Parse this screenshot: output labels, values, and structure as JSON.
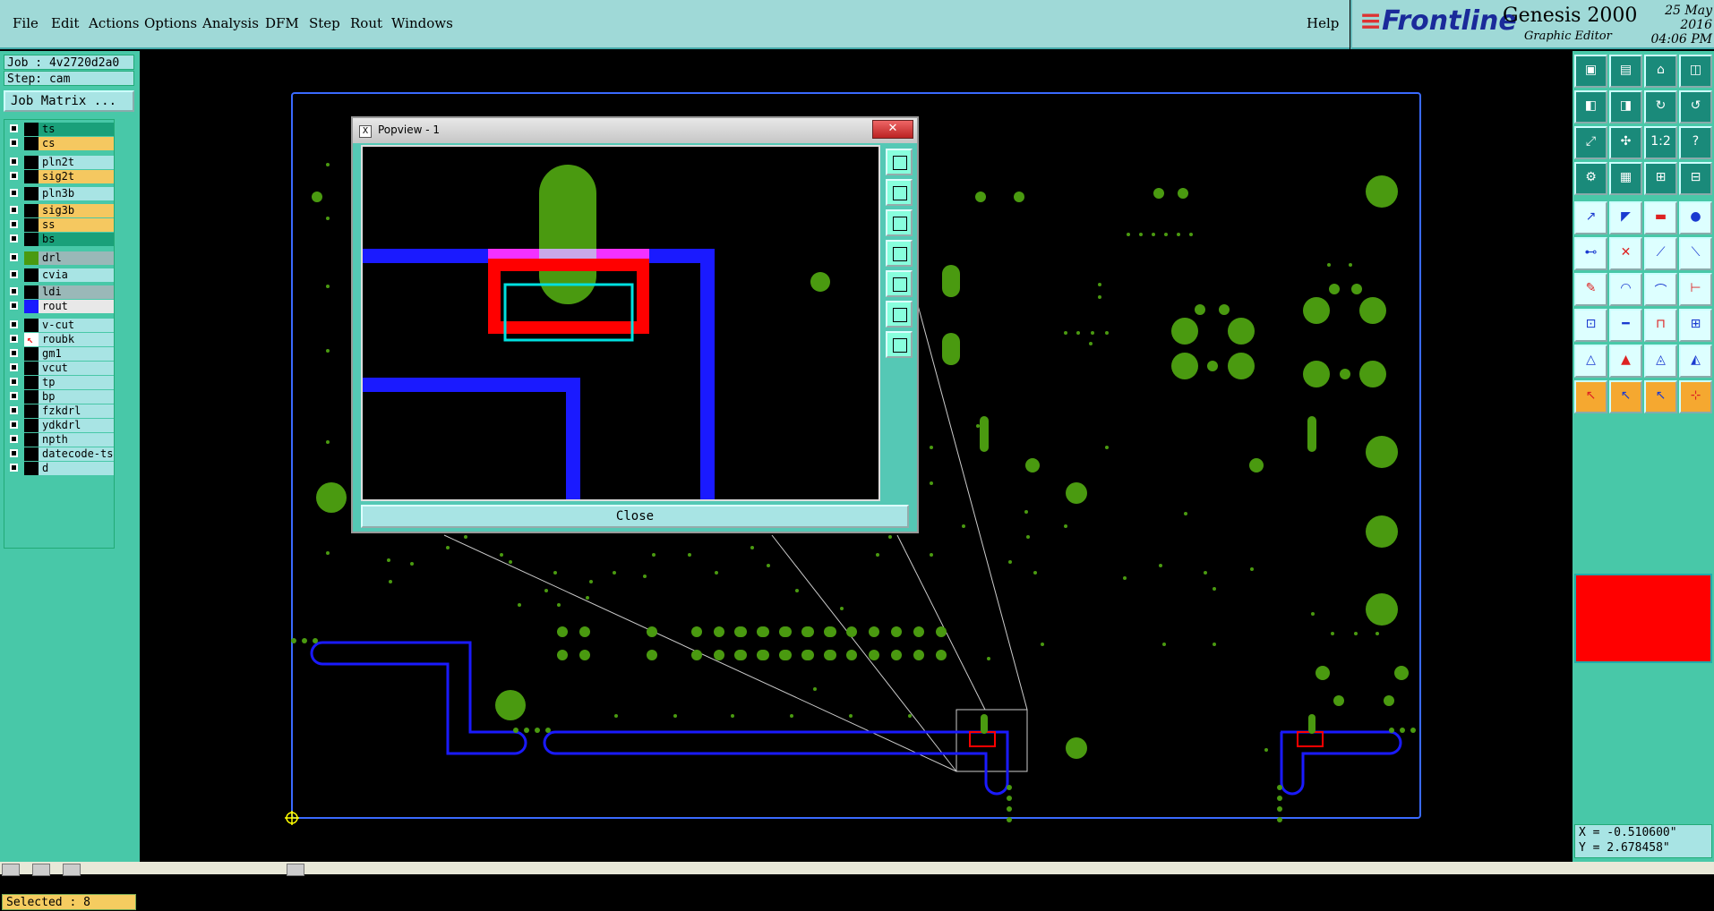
{
  "menu": {
    "items": [
      "File",
      "Edit",
      "Actions",
      "Options",
      "Analysis",
      "DFM",
      "Step",
      "Rout",
      "Windows"
    ],
    "help": "Help"
  },
  "brand": {
    "logo": "Frontline",
    "product": "Genesis 2000",
    "subtitle": "Graphic Editor",
    "date": "25 May 2016",
    "time": "04:06 PM"
  },
  "job": {
    "job_label": "Job : 4v2720d2a0",
    "step_label": "Step: cam",
    "matrix_button": "Job Matrix ..."
  },
  "layers": [
    {
      "name": "ts",
      "bg": "#1aa07a",
      "color": "#000"
    },
    {
      "name": "cs",
      "bg": "#f5c860",
      "color": "#000"
    },
    {
      "name": "pln2t",
      "bg": "#a8e4e4",
      "color": "#000"
    },
    {
      "name": "sig2t",
      "bg": "#f5c860",
      "color": "#000"
    },
    {
      "name": "pln3b",
      "bg": "#a8e4e4",
      "color": "#000"
    },
    {
      "name": "sig3b",
      "bg": "#f5c860",
      "color": "#000"
    },
    {
      "name": "ss",
      "bg": "#f5c860",
      "color": "#000"
    },
    {
      "name": "bs",
      "bg": "#1aa07a",
      "color": "#000"
    },
    {
      "name": "drl",
      "bg": "#9ab8b8",
      "color": "#000",
      "swatch": "#4a9a10"
    },
    {
      "name": "cvia",
      "bg": "#a8e4e4",
      "color": "#000"
    },
    {
      "name": "ldi",
      "bg": "#9ab8b8",
      "color": "#000"
    },
    {
      "name": "rout",
      "bg": "#e8e8e8",
      "color": "#000",
      "swatch": "#1a1aff"
    },
    {
      "name": "v-cut",
      "bg": "#a8e4e4",
      "color": "#000"
    },
    {
      "name": "roubk",
      "bg": "#a8e4e4",
      "color": "#000",
      "work": true
    },
    {
      "name": "gm1",
      "bg": "#a8e4e4",
      "color": "#000"
    },
    {
      "name": "vcut",
      "bg": "#a8e4e4",
      "color": "#000"
    },
    {
      "name": "tp",
      "bg": "#a8e4e4",
      "color": "#000"
    },
    {
      "name": "bp",
      "bg": "#a8e4e4",
      "color": "#000"
    },
    {
      "name": "fzkdrl",
      "bg": "#a8e4e4",
      "color": "#000"
    },
    {
      "name": "ydkdrl",
      "bg": "#a8e4e4",
      "color": "#000"
    },
    {
      "name": "npth",
      "bg": "#a8e4e4",
      "color": "#000"
    },
    {
      "name": "datecode-ts",
      "bg": "#a8e4e4",
      "color": "#000"
    },
    {
      "name": "d",
      "bg": "#a8e4e4",
      "color": "#000"
    }
  ],
  "status": {
    "selected": "Selected : 8",
    "x": "X = -0.510600\"",
    "y": "Y = 2.678458\""
  },
  "popup": {
    "title": "Popview - 1",
    "close_x": "✕",
    "close_button": "Close"
  },
  "colors": {
    "board_outline": "#3a6aff",
    "pad": "#4a9a10",
    "rout": "#1a1aff",
    "highlight": "#ff0000",
    "select": "#00e0e0",
    "magenta": "#ff33ff",
    "panel": "#48c8a8"
  },
  "toolbar_icons": [
    "open-icon",
    "save-icon",
    "home-icon",
    "window-icon",
    "back-icon",
    "forward-icon",
    "refresh-icon",
    "rotate-icon",
    "fit-icon",
    "zoom-icon",
    "scale-1-2-icon",
    "help-icon",
    "settings-icon",
    "grid-icon",
    "snap-icon",
    "snap-red-icon",
    "pin-icon",
    "pointer-icon",
    "measure-icon",
    "pad-icon",
    "connect-icon",
    "cross-icon",
    "line-icon",
    "line2-icon",
    "draw-icon",
    "arc-icon",
    "curve-icon",
    "polarity-icon",
    "select-icon",
    "minus-icon",
    "bracket-icon",
    "layers-icon",
    "triangle-icon",
    "triangle2-icon",
    "triangle3-icon",
    "triangle4-icon",
    "cursor-icon",
    "cursor2-icon",
    "cursor3-icon",
    "node-icon"
  ]
}
